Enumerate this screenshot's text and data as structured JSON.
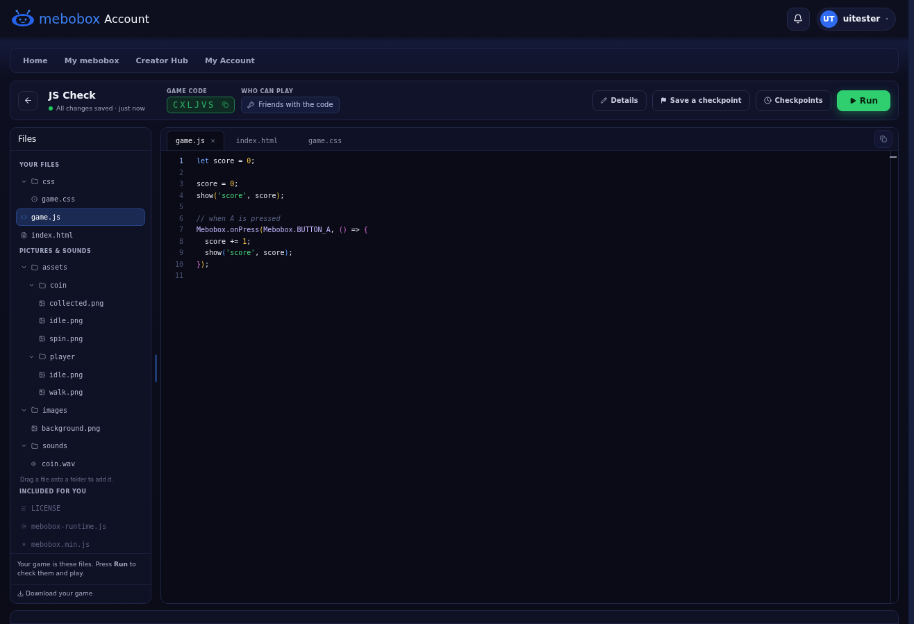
{
  "header": {
    "brand": "mebobox",
    "section": "Account",
    "user": {
      "initials": "UT",
      "name": "uitester",
      "caret": "·"
    }
  },
  "nav": [
    {
      "label": "Home",
      "selected": false
    },
    {
      "label": "My mebobox",
      "selected": false
    },
    {
      "label": "Creator Hub",
      "selected": false
    },
    {
      "label": "My Account",
      "selected": false
    }
  ],
  "project": {
    "title": "JS Check",
    "status": "All changes saved · just now",
    "saved": true,
    "code_label": "GAME CODE",
    "code": "CXLJVS",
    "access_label": "WHO CAN PLAY",
    "access": "Friends with the code",
    "actions": [
      {
        "label": "Details",
        "kind": "pencil"
      },
      {
        "label": "Save a checkpoint",
        "kind": "flag"
      },
      {
        "label": "Checkpoints",
        "kind": "clock"
      },
      {
        "label": "Run",
        "kind": "run"
      }
    ]
  },
  "files": {
    "title": "Files",
    "sections": [
      {
        "title": "YOUR FILES",
        "muted": false,
        "items": [
          {
            "name": "css",
            "kind": "folder",
            "expanded": true,
            "children": [
              {
                "name": "game.css",
                "kind": "style",
                "selected": false
              }
            ]
          },
          {
            "name": "game.js",
            "kind": "code",
            "selected": true
          },
          {
            "name": "index.html",
            "kind": "doc",
            "selected": false
          }
        ]
      },
      {
        "title": "PICTURES & SOUNDS",
        "muted": false,
        "hint": "Drag a file onto a folder to add it.",
        "items": [
          {
            "name": "assets",
            "kind": "folder",
            "expanded": true,
            "children": [
              {
                "name": "coin",
                "kind": "folder",
                "expanded": true,
                "children": [
                  {
                    "name": "collected.png",
                    "kind": "image",
                    "selected": false
                  },
                  {
                    "name": "idle.png",
                    "kind": "image",
                    "selected": false
                  },
                  {
                    "name": "spin.png",
                    "kind": "image",
                    "selected": false
                  }
                ]
              },
              {
                "name": "player",
                "kind": "folder",
                "expanded": true,
                "children": [
                  {
                    "name": "idle.png",
                    "kind": "image",
                    "selected": false
                  },
                  {
                    "name": "walk.png",
                    "kind": "image",
                    "selected": false
                  }
                ]
              }
            ]
          },
          {
            "name": "images",
            "kind": "folder",
            "expanded": true,
            "children": [
              {
                "name": "background.png",
                "kind": "image",
                "selected": false
              }
            ]
          },
          {
            "name": "sounds",
            "kind": "folder",
            "expanded": true,
            "children": [
              {
                "name": "coin.wav",
                "kind": "audio",
                "selected": false
              }
            ]
          }
        ]
      },
      {
        "title": "INCLUDED FOR YOU",
        "muted": true,
        "items": [
          {
            "name": "LICENSE",
            "kind": "text",
            "selected": false
          },
          {
            "name": "mebobox-runtime.js",
            "kind": "gear",
            "selected": false
          },
          {
            "name": "mebobox.min.js",
            "kind": "star",
            "selected": false
          }
        ]
      }
    ],
    "note": "Your game is these files. Press **Run** to check them and play.",
    "download": "Download your game"
  },
  "editor": {
    "tabs": [
      {
        "label": "game.js",
        "selected": true,
        "close": "×"
      },
      {
        "label": "index.html",
        "selected": false
      },
      {
        "label": "game.css",
        "selected": false
      }
    ],
    "lines": [
      {
        "number": "1",
        "current": true,
        "kind": "code",
        "tokens": [
          {
            "text": "let",
            "kind": "keyword"
          },
          {
            "text": " score = ",
            "kind": "plain"
          },
          {
            "text": "0",
            "kind": "number"
          },
          {
            "text": ";",
            "kind": "plain"
          }
        ]
      },
      {
        "number": "2",
        "current": false,
        "kind": "blank"
      },
      {
        "number": "3",
        "current": false,
        "kind": "code",
        "tokens": [
          {
            "text": "score = ",
            "kind": "plain"
          },
          {
            "text": "0",
            "kind": "number"
          },
          {
            "text": ";",
            "kind": "plain"
          }
        ]
      },
      {
        "number": "4",
        "current": false,
        "kind": "code",
        "tokens": [
          {
            "text": "show",
            "kind": "plain"
          },
          {
            "text": "(",
            "kind": "paren"
          },
          {
            "text": "'score'",
            "kind": "string"
          },
          {
            "text": ", score",
            "kind": "plain"
          },
          {
            "text": ")",
            "kind": "paren"
          },
          {
            "text": ";",
            "kind": "plain"
          }
        ]
      },
      {
        "number": "5",
        "current": false,
        "kind": "blank"
      },
      {
        "number": "6",
        "current": false,
        "kind": "comment",
        "tokens": [
          {
            "text": "// when A is pressed",
            "kind": "comment"
          }
        ]
      },
      {
        "number": "7",
        "current": false,
        "kind": "code",
        "tokens": [
          {
            "text": "Mebobox.onPress",
            "kind": "name"
          },
          {
            "text": "(",
            "kind": "paren"
          },
          {
            "text": "Mebobox.BUTTON_A",
            "kind": "name"
          },
          {
            "text": ", ",
            "kind": "plain"
          },
          {
            "text": "()",
            "kind": "brace"
          },
          {
            "text": " => ",
            "kind": "plain"
          },
          {
            "text": "{",
            "kind": "brace"
          }
        ]
      },
      {
        "number": "8",
        "current": false,
        "kind": "code",
        "tokens": [
          {
            "text": "  score += ",
            "kind": "plain"
          },
          {
            "text": "1",
            "kind": "number"
          },
          {
            "text": ";",
            "kind": "plain"
          }
        ]
      },
      {
        "number": "9",
        "current": false,
        "kind": "code",
        "tokens": [
          {
            "text": "  show",
            "kind": "plain"
          },
          {
            "text": "(",
            "kind": "inner"
          },
          {
            "text": "'score'",
            "kind": "string"
          },
          {
            "text": ", score",
            "kind": "plain"
          },
          {
            "text": ")",
            "kind": "inner"
          },
          {
            "text": ";",
            "kind": "plain"
          }
        ]
      },
      {
        "number": "10",
        "current": false,
        "kind": "code",
        "tokens": [
          {
            "text": "}",
            "kind": "brace"
          },
          {
            "text": ")",
            "kind": "paren"
          },
          {
            "text": ";",
            "kind": "plain"
          }
        ]
      },
      {
        "number": "11",
        "current": false,
        "kind": "blank"
      }
    ]
  }
}
